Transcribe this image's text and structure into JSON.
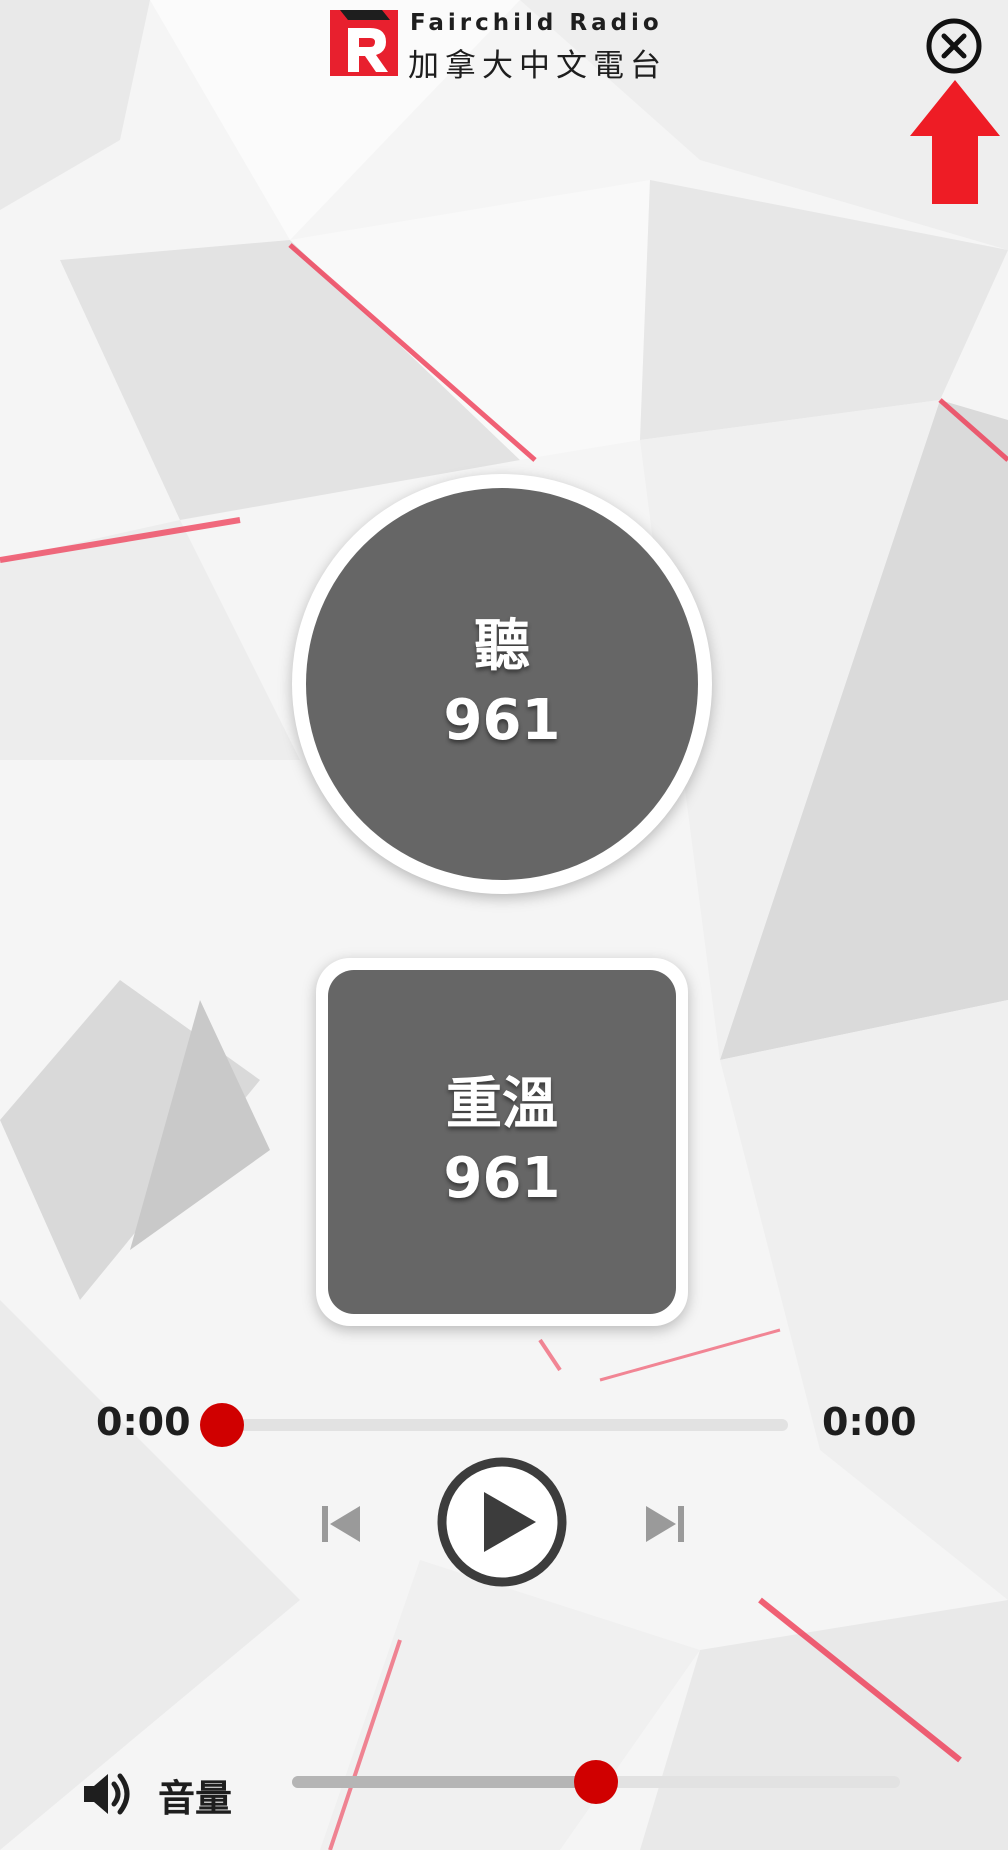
{
  "header": {
    "brand_en": "Fairchild Radio",
    "brand_zh": "加拿大中文電台",
    "close_icon": "close-circle-icon",
    "annotation_icon": "red-up-arrow-icon"
  },
  "live": {
    "line1": "聽",
    "line2": "961"
  },
  "replay": {
    "line1": "重溫",
    "line2": "961"
  },
  "player": {
    "elapsed": "0:00",
    "duration": "0:00",
    "progress_fraction": 0.0,
    "prev_icon": "skip-previous-icon",
    "play_icon": "play-icon",
    "next_icon": "skip-next-icon"
  },
  "volume": {
    "icon": "speaker-icon",
    "label": "音量",
    "level_fraction": 0.5
  },
  "colors": {
    "accent": "#d00000",
    "button_fill": "#666666",
    "arrow": "#ee1c25",
    "logo_red": "#e8202e"
  }
}
